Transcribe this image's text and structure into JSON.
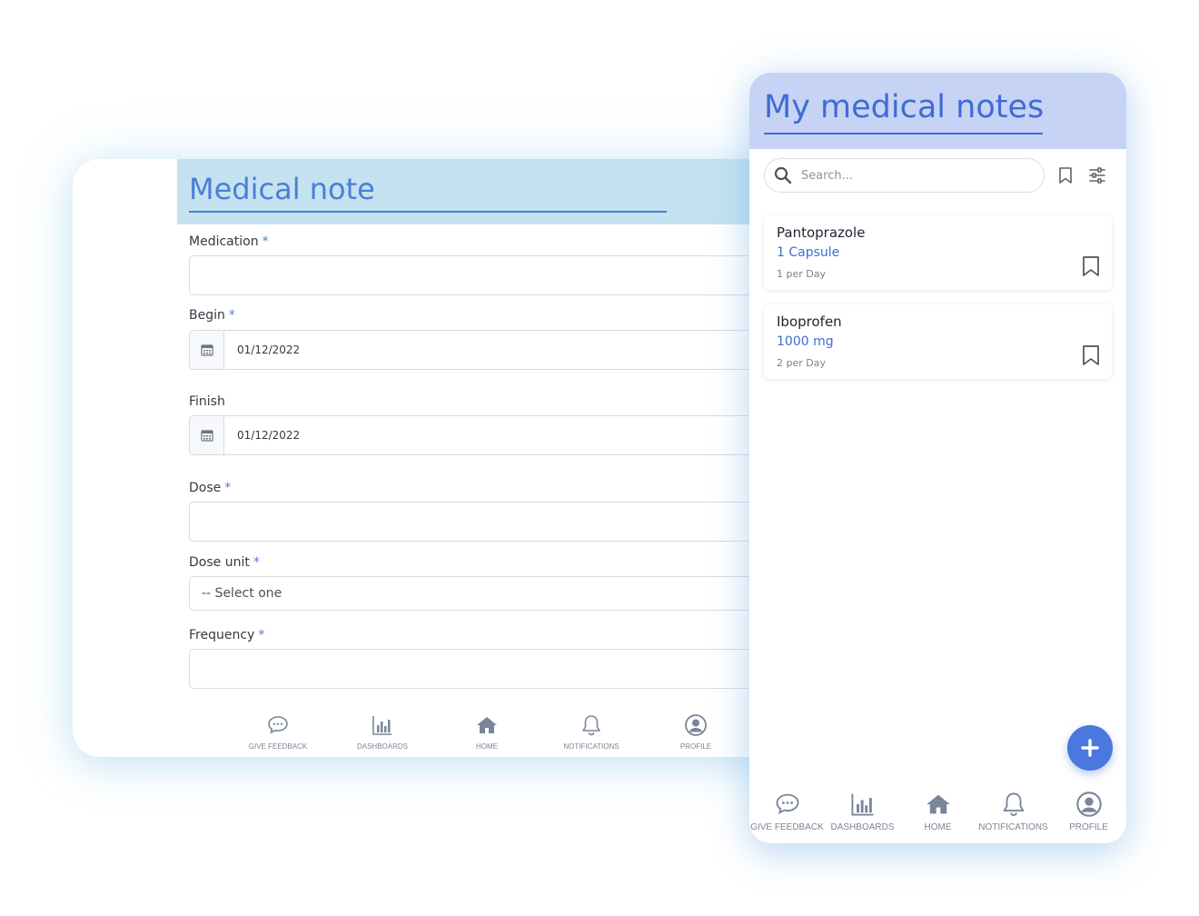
{
  "form": {
    "title": "Medical note",
    "fields": {
      "medication": {
        "label": "Medication",
        "required": "*",
        "value": ""
      },
      "begin": {
        "label": "Begin",
        "required": "*",
        "value": "01/12/2022"
      },
      "finish": {
        "label": "Finish",
        "value": "01/12/2022"
      },
      "dose": {
        "label": "Dose",
        "required": "*",
        "value": ""
      },
      "dose_unit": {
        "label": "Dose unit",
        "required": "*",
        "selected": "-- Select one"
      },
      "frequency": {
        "label": "Frequency",
        "required": "*",
        "value": ""
      }
    },
    "nav": [
      {
        "label": "GIVE FEEDBACK",
        "icon": "chat-icon"
      },
      {
        "label": "DASHBOARDS",
        "icon": "bar-chart-icon"
      },
      {
        "label": "HOME",
        "icon": "home-icon"
      },
      {
        "label": "NOTIFICATIONS",
        "icon": "bell-icon"
      },
      {
        "label": "PROFILE",
        "icon": "user-circle-icon"
      }
    ]
  },
  "phone": {
    "title": "My medical notes",
    "search_placeholder": "Search...",
    "notes": [
      {
        "name": "Pantoprazole",
        "dose": "1 Capsule",
        "frequency": "1 per Day"
      },
      {
        "name": "Iboprofen",
        "dose": "1000 mg",
        "frequency": "2 per Day"
      }
    ],
    "nav": [
      {
        "label": "GIVE FEEDBACK",
        "icon": "chat-icon"
      },
      {
        "label": "DASHBOARDS",
        "icon": "bar-chart-icon"
      },
      {
        "label": "HOME",
        "icon": "home-icon"
      },
      {
        "label": "NOTIFICATIONS",
        "icon": "bell-icon"
      },
      {
        "label": "PROFILE",
        "icon": "user-circle-icon"
      }
    ]
  },
  "colors": {
    "accent": "#4a7fd6",
    "form_header_bg": "#c4e2f0",
    "phone_header_bg": "#c7d3f5",
    "fab_bg": "#4a78de",
    "nav_icon": "#7a8597"
  }
}
